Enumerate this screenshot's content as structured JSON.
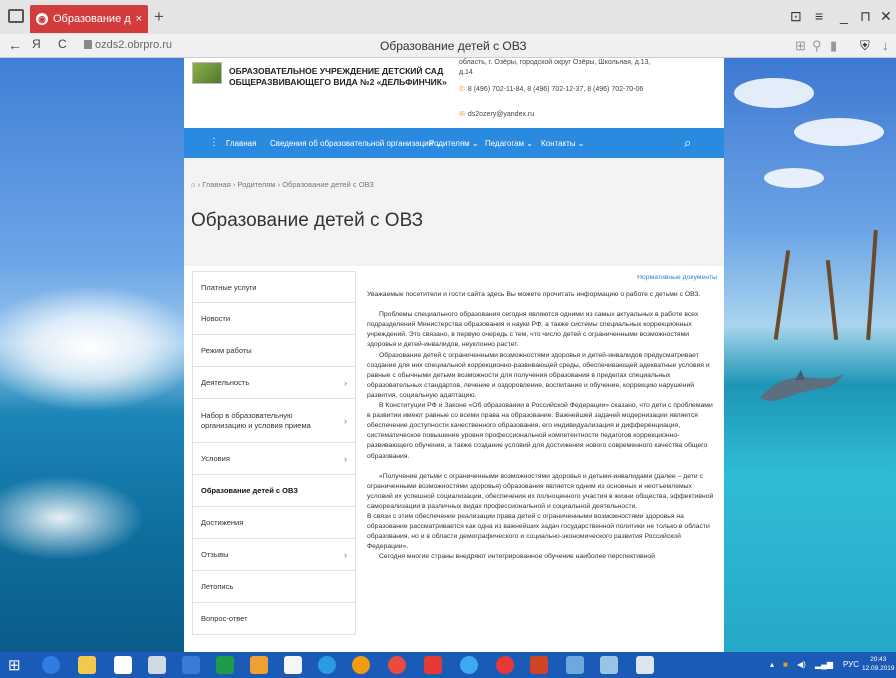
{
  "browser": {
    "tab_title": "Образование детей с О",
    "tab_close": "×",
    "new_tab": "+",
    "url": "ozds2.obrpro.ru",
    "page_title": "Образование детей с ОВЗ",
    "back": "←",
    "forward": "Я",
    "reload": "C",
    "window_controls": [
      "⊡",
      "≡",
      "_",
      "⊓",
      "✕"
    ]
  },
  "site": {
    "org_name": "ОБРАЗОВАТЕЛЬНОЕ УЧРЕЖДЕНИЕ ДЕТСКИЙ САД ОБЩЕРАЗВИВАЮЩЕГО ВИДА №2 «ДЕЛЬФИНЧИК»",
    "address": "область, г. Озёры, городской округ Озёры, Школьная, д.13, д.14",
    "phones": "8 (496) 702-11-84, 8 (496) 702-12-37, 8 (496) 702-70-06",
    "email": "ds2ozery@yandex.ru",
    "nav": {
      "home": "Главная",
      "about": "Сведения об образовательной организации ⌄",
      "parents": "Родителям ⌄",
      "teachers": "Педагогам ⌄",
      "contacts": "Контакты ⌄"
    },
    "breadcrumb": "› Главная › Родителям › Образование детей с ОВЗ",
    "heading": "Образование детей с ОВЗ",
    "menu": [
      "Платные услуги",
      "Новости",
      "Режим работы",
      "Деятельность",
      "Набор в образовательную организацию и условия приема",
      "Условия",
      "Образование детей с ОВЗ",
      "Достижения",
      "Отзывы",
      "Летопись",
      "Вопрос-ответ"
    ],
    "content": {
      "link": "Нормативные документы",
      "intro": "Уважаемые посетители и гости сайта здесь Вы можете прочитать информацию о работе с детьми с ОВЗ.",
      "p1": "Проблемы специального образования сегодня являются одними из самых актуальных в работе всех подразделений Министерства образования и науки РФ, а также системы специальных коррекционных учреждений. Это связано, в первую очередь с тем, что число детей с ограниченными возможностями здоровья и детей-инвалидов, неуклонно растет.",
      "p2": "Образование детей с ограниченными возможностями здоровья и детей-инвалидов предусматривает создание для них специальной коррекционно-развивающей среды, обеспечивающей адекватные условия и равные с обычными детьми возможности для получения образования в пределах специальных образовательных стандартов, лечение и оздоровление, воспитание и обучение, коррекцию нарушений развития, социальную адаптацию.",
      "p3": "В Конституции РФ и Законе «Об образовании в Российской Федерации» сказано, что дети с проблемами в развитии имеют равные со всеми права на образование. Важнейшей задачей модернизации является обеспечение доступности качественного образования, его индивидуализация и дифференциация, систематическое повышение уровня профессиональной компетентности педагогов коррекционно-развивающего обучения, а также создание условий для достижения нового современного качества общего образования.",
      "p4": "«Получение детьми с ограниченными возможностями здоровья и детьми-инвалидами (далее – дети с ограниченными возможностями здоровья) образования является одним из основных и неотъемлемых условий их успешной социализации, обеспечения их полноценного участия в жизни общества, эффективной самореализации в различных видах профессиональной и социальной деятельности.",
      "p5": "В связи с этим обеспечение реализации права детей с ограниченными возможностями здоровья на образование рассматривается как одна из важнейших задач государственной политики не только в области образования, но и в области демографического и социально-экономического развития Российской Федерации».",
      "p6": "Сегодня многие страны внедряют интегрированное обучение наиболее перспективной"
    }
  },
  "taskbar": {
    "lang": "РУС",
    "time": "20:43",
    "date": "12.09.2019"
  },
  "colors": {
    "nav_blue": "#2a8ae0",
    "tab_red": "#d33c3c",
    "taskbar": "#1b5bb8",
    "link": "#2a84d4"
  }
}
